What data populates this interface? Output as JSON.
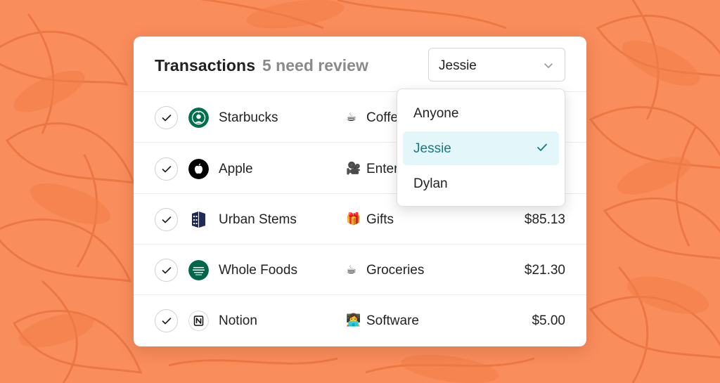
{
  "header": {
    "title": "Transactions",
    "subtitle": "5 need review",
    "assignee_select_value": "Jessie"
  },
  "transactions": [
    {
      "merchant": "Starbucks",
      "merchant_icon": "starbucks-logo-icon",
      "category_emoji": "☕",
      "category": "Coffee",
      "amount": ""
    },
    {
      "merchant": "Apple",
      "merchant_icon": "apple-logo-icon",
      "category_emoji": "🎥",
      "category": "Entertainment",
      "amount": ""
    },
    {
      "merchant": "Urban Stems",
      "merchant_icon": "urban-stems-logo-icon",
      "category_emoji": "🎁",
      "category": "Gifts",
      "amount": "$85.13"
    },
    {
      "merchant": "Whole Foods",
      "merchant_icon": "whole-foods-logo-icon",
      "category_emoji": "☕",
      "category": "Groceries",
      "amount": "$21.30"
    },
    {
      "merchant": "Notion",
      "merchant_icon": "notion-logo-icon",
      "category_emoji": "👩‍💻",
      "category": "Software",
      "amount": "$5.00"
    }
  ],
  "dropdown": {
    "options": [
      {
        "label": "Anyone",
        "selected": false
      },
      {
        "label": "Jessie",
        "selected": true
      },
      {
        "label": "Dylan",
        "selected": false
      }
    ]
  },
  "colors": {
    "background": "#fa8d5c",
    "selected_option_bg": "#e3f6f9",
    "selected_option_text": "#127a8a",
    "starbucks_green": "#00704a",
    "whole_foods_green": "#00674b",
    "urban_stems_navy": "#1f2a5a"
  }
}
